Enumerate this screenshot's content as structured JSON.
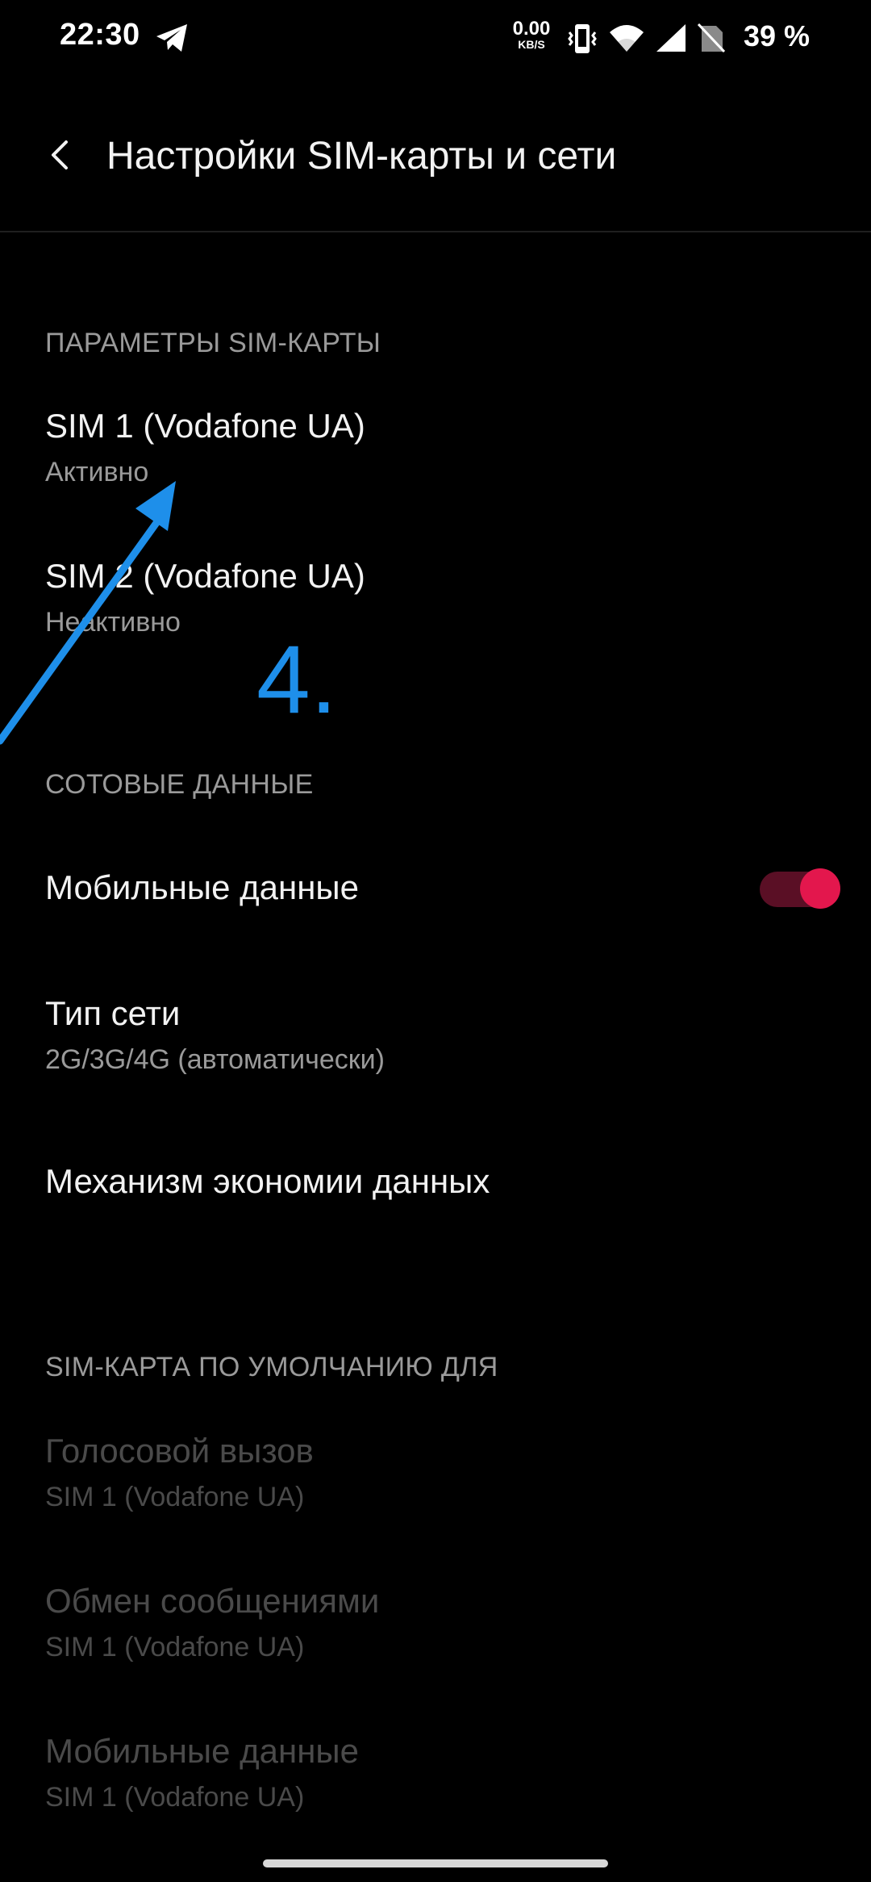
{
  "status_bar": {
    "time": "22:30",
    "net_speed_value": "0.00",
    "net_speed_unit": "KB/S",
    "battery": "39 %",
    "icons": [
      "telegram-icon",
      "vibrate-icon",
      "wifi-icon",
      "signal-icon",
      "no-sim-icon"
    ]
  },
  "toolbar": {
    "title": "Настройки SIM-карты и сети",
    "back_icon": "chevron-left-icon"
  },
  "sections": {
    "sim_params": {
      "header": "ПАРАМЕТРЫ SIM-КАРТЫ",
      "sim1": {
        "title": "SIM 1  (Vodafone UA)",
        "summary": "Активно"
      },
      "sim2": {
        "title": "SIM 2  (Vodafone UA)",
        "summary": "Неактивно"
      }
    },
    "cellular": {
      "header": "СОТОВЫЕ ДАННЫЕ",
      "mobile_data": {
        "title": "Мобильные данные",
        "enabled": true
      },
      "network_type": {
        "title": "Тип сети",
        "summary": "2G/3G/4G (автоматически)"
      },
      "data_saver": {
        "title": "Механизм экономии данных"
      }
    },
    "default_sim": {
      "header": "SIM-КАРТА ПО УМОЛЧАНИЮ ДЛЯ",
      "voice": {
        "title": "Голосовой вызов",
        "summary": "SIM 1  (Vodafone UA)"
      },
      "messages": {
        "title": "Обмен сообщениями",
        "summary": "SIM 1  (Vodafone UA)"
      },
      "data": {
        "title": "Мобильные данные",
        "summary": "SIM 1  (Vodafone UA)"
      }
    }
  },
  "annotation": {
    "label": "4.",
    "color": "#1e8fea"
  },
  "colors": {
    "background": "#000000",
    "accent": "#e3174d",
    "secondary_text": "#9a9a9a",
    "disabled_text": "#4a4a4a"
  }
}
